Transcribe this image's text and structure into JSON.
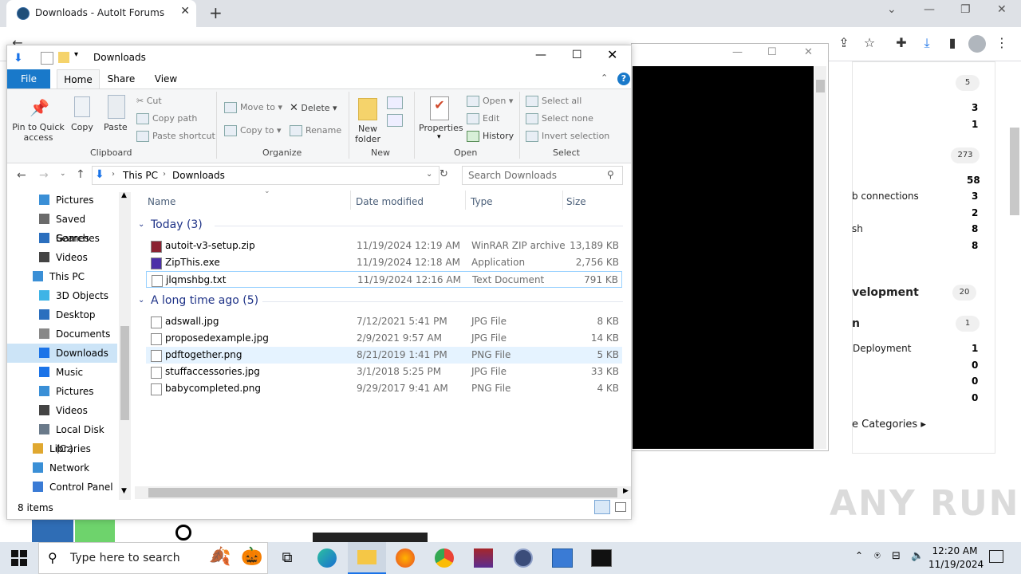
{
  "browser": {
    "tab_title": "Downloads - AutoIt Forums",
    "new_tab": "+",
    "controls": {
      "chevron": "⌄",
      "minimize": "—",
      "restore": "❐",
      "close": "✕"
    }
  },
  "web_page": {
    "badges": [
      "5",
      "273",
      "20",
      "1"
    ],
    "counts_a": [
      "3",
      "1"
    ],
    "counts_b": [
      "58",
      "3",
      "2",
      "8",
      "8"
    ],
    "text_conn": "b connections",
    "text_sh": "sh",
    "heading_dev": "velopment",
    "heading_n": "n",
    "deploy": "Deployment",
    "counts_c": [
      "1",
      "0",
      "0",
      "0"
    ],
    "categories": "e Categories ▸"
  },
  "explorer": {
    "title": "Downloads",
    "tabs": {
      "file": "File",
      "home": "Home",
      "share": "Share",
      "view": "View"
    },
    "ribbon": {
      "pin": "Pin to Quick access",
      "copy": "Copy",
      "paste": "Paste",
      "cut": "Cut",
      "copy_path": "Copy path",
      "paste_shortcut": "Paste shortcut",
      "clipboard": "Clipboard",
      "move_to": "Move to",
      "copy_to": "Copy to",
      "delete": "Delete",
      "rename": "Rename",
      "organize": "Organize",
      "new_folder": "New folder",
      "new": "New",
      "properties": "Properties",
      "open": "Open",
      "edit": "Edit",
      "history": "History",
      "open_group": "Open",
      "select_all": "Select all",
      "select_none": "Select none",
      "invert": "Invert selection",
      "select": "Select"
    },
    "address": {
      "this_pc": "This PC",
      "downloads": "Downloads",
      "search_placeholder": "Search Downloads"
    },
    "nav": [
      {
        "label": "Pictures",
        "icon": "pictures-icon"
      },
      {
        "label": "Saved Games",
        "icon": "saved-games-icon"
      },
      {
        "label": "Searches",
        "icon": "searches-icon"
      },
      {
        "label": "Videos",
        "icon": "videos-icon"
      },
      {
        "label": "This PC",
        "icon": "this-pc-icon"
      },
      {
        "label": "3D Objects",
        "icon": "objects-icon"
      },
      {
        "label": "Desktop",
        "icon": "desktop-icon"
      },
      {
        "label": "Documents",
        "icon": "documents-icon"
      },
      {
        "label": "Downloads",
        "icon": "downloads-icon"
      },
      {
        "label": "Music",
        "icon": "music-icon"
      },
      {
        "label": "Pictures",
        "icon": "pictures-icon"
      },
      {
        "label": "Videos",
        "icon": "videos-icon"
      },
      {
        "label": "Local Disk (C:)",
        "icon": "disk-icon"
      },
      {
        "label": "Libraries",
        "icon": "libraries-icon"
      },
      {
        "label": "Network",
        "icon": "network-icon"
      },
      {
        "label": "Control Panel",
        "icon": "control-panel-icon"
      }
    ],
    "columns": {
      "name": "Name",
      "date": "Date modified",
      "type": "Type",
      "size": "Size"
    },
    "group_today": "Today (3)",
    "group_old": "A long time ago (5)",
    "files_today": [
      {
        "name": "autoit-v3-setup.zip",
        "date": "11/19/2024 12:19 AM",
        "type": "WinRAR ZIP archive",
        "size": "13,189 KB"
      },
      {
        "name": "ZipThis.exe",
        "date": "11/19/2024 12:18 AM",
        "type": "Application",
        "size": "2,756 KB"
      },
      {
        "name": "jlqmshbg.txt",
        "date": "11/19/2024 12:16 AM",
        "type": "Text Document",
        "size": "791 KB"
      }
    ],
    "files_old": [
      {
        "name": "adswall.jpg",
        "date": "7/12/2021 5:41 PM",
        "type": "JPG File",
        "size": "8 KB"
      },
      {
        "name": "proposedexample.jpg",
        "date": "2/9/2021 9:57 AM",
        "type": "JPG File",
        "size": "14 KB"
      },
      {
        "name": "pdftogether.png",
        "date": "8/21/2019 1:41 PM",
        "type": "PNG File",
        "size": "5 KB"
      },
      {
        "name": "stuffaccessories.jpg",
        "date": "3/1/2018 5:25 PM",
        "type": "JPG File",
        "size": "33 KB"
      },
      {
        "name": "babycompleted.png",
        "date": "9/29/2017 9:41 AM",
        "type": "PNG File",
        "size": "4 KB"
      }
    ],
    "status": "8 items"
  },
  "taskbar": {
    "search_placeholder": "Type here to search",
    "time": "12:20 AM",
    "date": "11/19/2024"
  },
  "watermark": "ANY RUN"
}
